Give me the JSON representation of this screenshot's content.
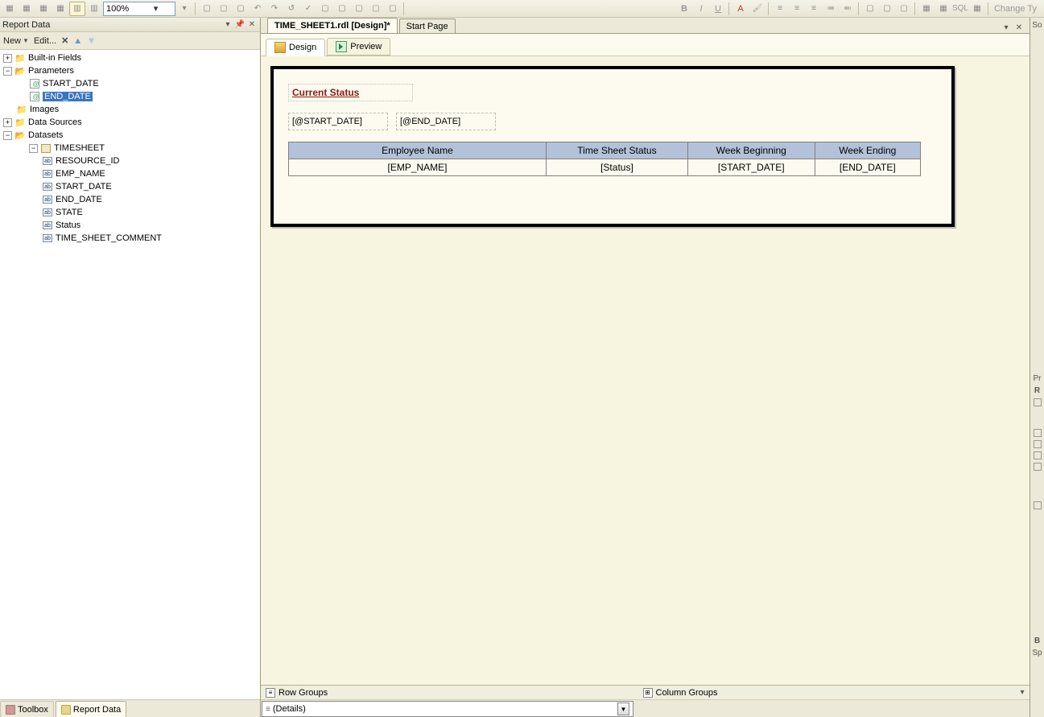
{
  "toolbar": {
    "zoom": "100%",
    "change_type": "Change Ty"
  },
  "left_panel": {
    "title": "Report Data",
    "new": "New",
    "edit": "Edit..."
  },
  "tree": {
    "builtin": "Built-in Fields",
    "parameters": "Parameters",
    "param_start": "START_DATE",
    "param_end": "END_DATE",
    "images": "Images",
    "data_sources": "Data Sources",
    "datasets": "Datasets",
    "ds_name": "TIMESHEET",
    "fields": {
      "resource_id": "RESOURCE_ID",
      "emp_name": "EMP_NAME",
      "start_date": "START_DATE",
      "end_date": "END_DATE",
      "state": "STATE",
      "status": "Status",
      "comment": "TIME_SHEET_COMMENT"
    }
  },
  "tabs": {
    "doc1": "TIME_SHEET1.rdl [Design]",
    "doc1_mod": "*",
    "start": "Start Page",
    "design": "Design",
    "preview": "Preview"
  },
  "report": {
    "title": "Current Status",
    "p_start": "[@START_DATE]",
    "p_end": "[@END_DATE]",
    "headers": {
      "emp": "Employee Name",
      "status": "Time Sheet Status",
      "wb": "Week Beginning",
      "we": "Week Ending"
    },
    "row": {
      "emp": "[EMP_NAME]",
      "status": "[Status]",
      "wb": "[START_DATE]",
      "we": "[END_DATE]"
    }
  },
  "groups": {
    "row": "Row Groups",
    "col": "Column Groups",
    "detail": "(Details)"
  },
  "bottom_tabs": {
    "toolbox": "Toolbox",
    "report_data": "Report Data"
  },
  "right_side": {
    "so": "So",
    "pr": "Pr",
    "r": "R",
    "b": "B",
    "sp": "Sp"
  }
}
